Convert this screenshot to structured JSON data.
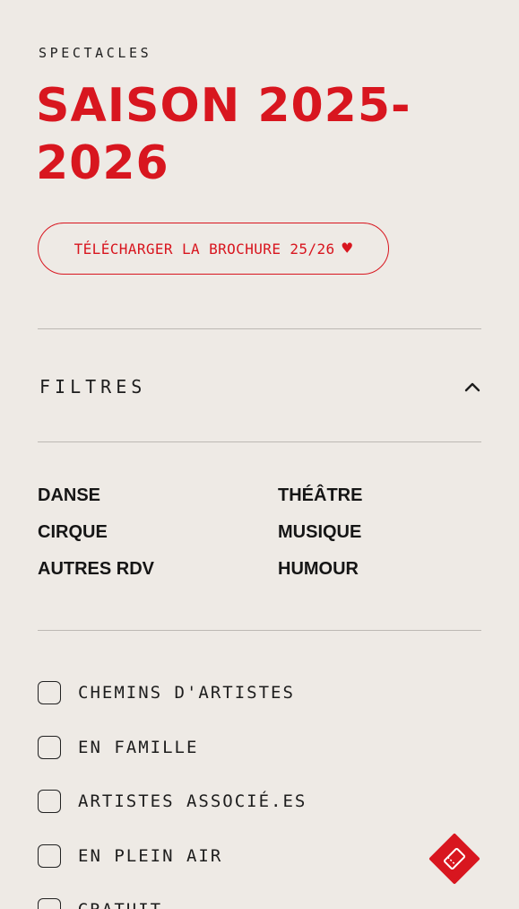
{
  "header": {
    "eyebrow": "SPECTACLES",
    "title": "SAISON 2025-2026"
  },
  "brochure": {
    "label": "TÉLÉCHARGER LA BROCHURE 25/26",
    "icon": "heart-icon",
    "heart_glyph": "♥"
  },
  "filters": {
    "label": "FILTRES",
    "state_icon": "chevron-up-icon",
    "categories": [
      {
        "label": "DANSE"
      },
      {
        "label": "THÉÂTRE"
      },
      {
        "label": "CIRQUE"
      },
      {
        "label": "MUSIQUE"
      },
      {
        "label": "AUTRES RDV"
      },
      {
        "label": "HUMOUR"
      }
    ],
    "tags": [
      {
        "label": "CHEMINS D'ARTISTES",
        "checked": false
      },
      {
        "label": "EN FAMILLE",
        "checked": false
      },
      {
        "label": "ARTISTES ASSOCIÉ.ES",
        "checked": false
      },
      {
        "label": "EN PLEIN AIR",
        "checked": false
      },
      {
        "label": "GRATUIT",
        "checked": false
      }
    ]
  },
  "fab": {
    "icon": "ticket-icon"
  },
  "colors": {
    "accent": "#d8161f",
    "background": "#eeeae5",
    "text": "#1d1d1d",
    "divider": "#bcb8b3"
  }
}
